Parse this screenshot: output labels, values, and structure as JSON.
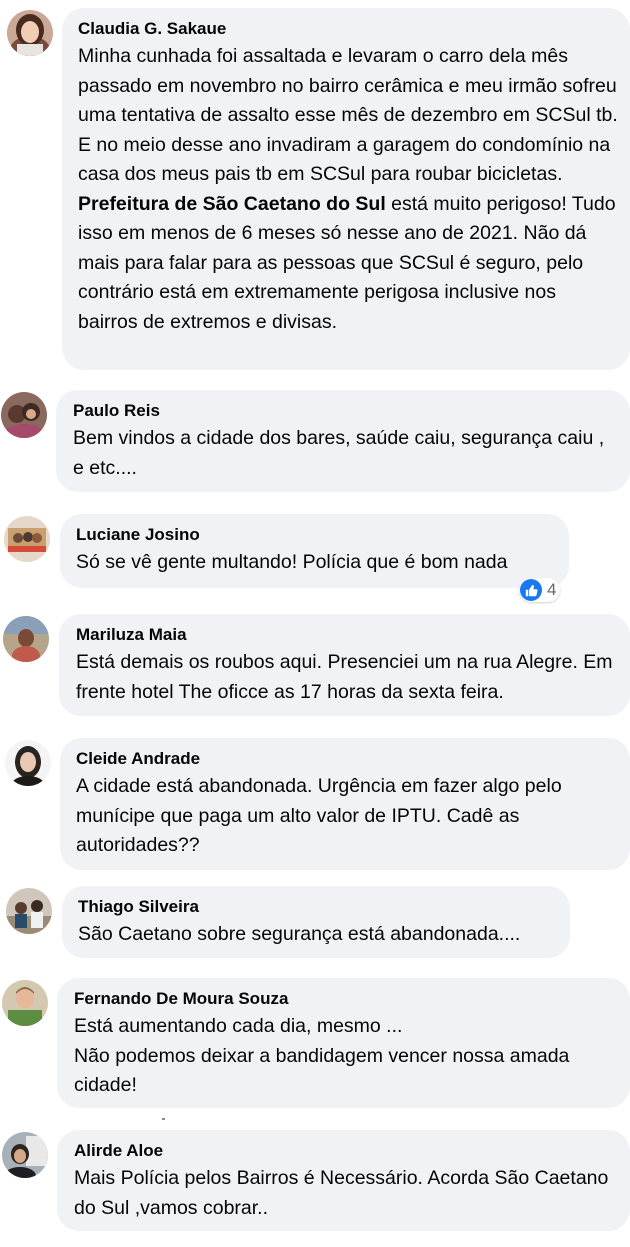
{
  "comments": [
    {
      "author": "Claudia G. Sakaue",
      "text_before_mention": "Minha cunhada foi assaltada e levaram o carro dela mês passado em novembro no bairro cerâmica e meu irmão sofreu uma tentativa de assalto esse mês de dezembro em SCSul tb. E no meio desse ano invadiram a garagem do condomínio na casa dos meus pais tb em SCSul para roubar bicicletas. ",
      "mention": "Prefeitura de São Caetano do Sul",
      "text_after_mention": " está muito perigoso! Tudo isso em menos de 6 meses só nesse ano de 2021. Não dá mais para falar para as pessoas que SCSul é seguro, pelo contrário está em extremamente perigosa inclusive nos bairros de extremos e divisas."
    },
    {
      "author": "Paulo Reis",
      "text": "Bem vindos a cidade dos bares, saúde caiu, segurança caiu , e etc...."
    },
    {
      "author": "Luciane Josino",
      "text": "Só se vê gente multando! Polícia que é bom nada",
      "reaction": {
        "icon": "like-icon",
        "count": "4",
        "color": "#1877f2"
      }
    },
    {
      "author": "Mariluza Maia",
      "text": "Está demais os roubos aqui. Presenciei um na rua Alegre. Em frente hotel The oficce as 17 horas da sexta feira."
    },
    {
      "author": "Cleide Andrade",
      "text": "A cidade está abandonada. Urgência em fazer algo pelo munícipe que paga um alto valor de IPTU. Cadê as autoridades??"
    },
    {
      "author": "Thiago Silveira",
      "text": "São Caetano sobre segurança está abandonada...."
    },
    {
      "author": "Fernando De Moura Souza",
      "text_line1": "Está aumentando cada dia, mesmo ...",
      "text_line2": "Não podemos deixar a bandidagem vencer nossa amada cidade!"
    },
    {
      "author": "Alirde Aloe",
      "text": "Mais Polícia pelos Bairros é Necessário. Acorda São Caetano do Sul ,vamos cobrar.."
    }
  ],
  "colors": {
    "bubble": "#f0f2f5",
    "text": "#050505",
    "like_blue": "#1877f2",
    "count_gray": "#65676b"
  }
}
